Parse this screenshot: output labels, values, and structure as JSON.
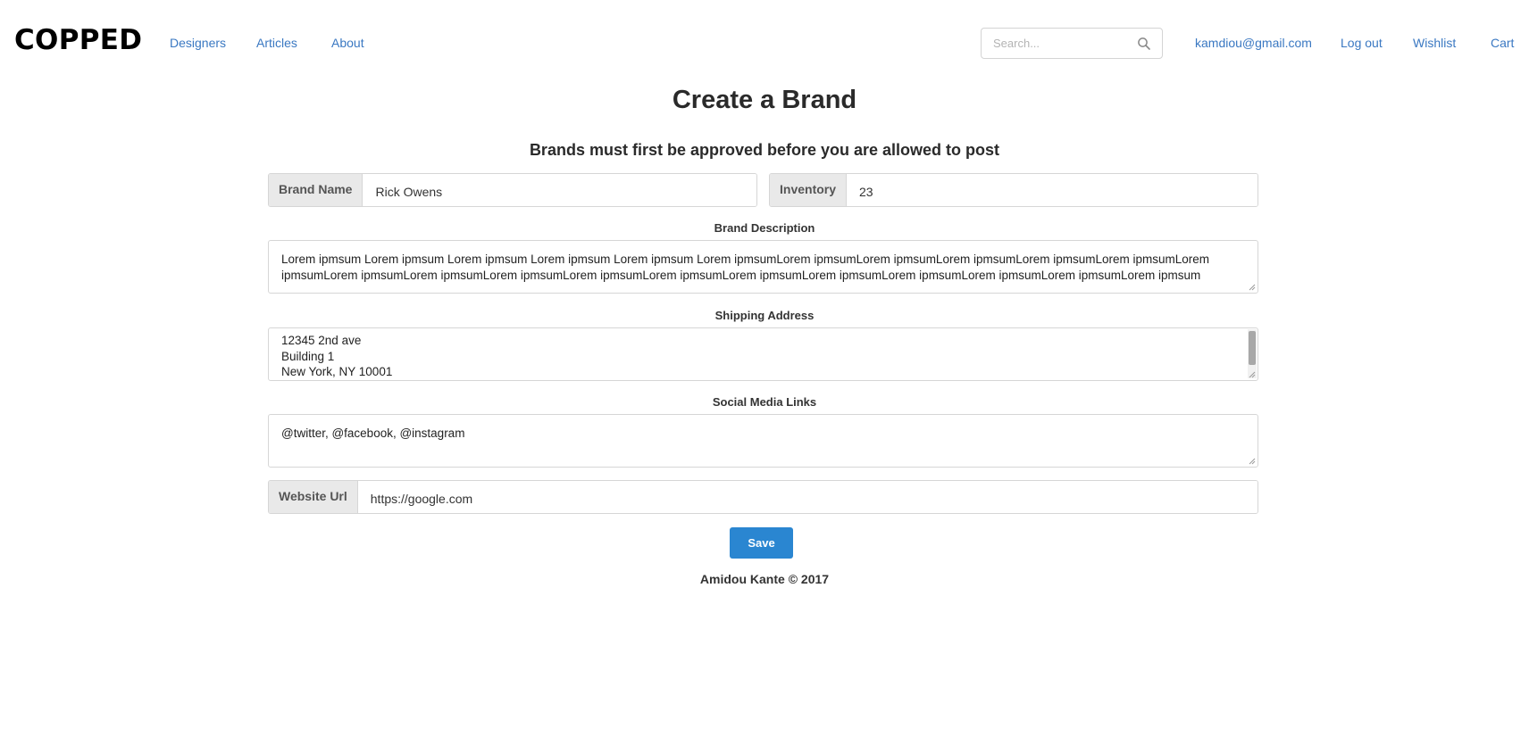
{
  "nav": {
    "logo": "COPPED",
    "links": [
      "Designers",
      "Articles",
      "About"
    ],
    "search_placeholder": "Search...",
    "user_email": "kamdiou@gmail.com",
    "logout": "Log out",
    "wishlist": "Wishlist",
    "cart": "Cart"
  },
  "page": {
    "title": "Create a Brand",
    "subtitle": "Brands must first be approved before you are allowed to post"
  },
  "form": {
    "brand_name_label": "Brand Name",
    "brand_name_value": "Rick Owens",
    "inventory_label": "Inventory",
    "inventory_value": "23",
    "description_label": "Brand Description",
    "description_lines": [
      "Lorem ipmsum Lorem ipmsum Lorem ipmsum Lorem ipmsum Lorem ipmsum Lorem ipmsumLorem ipmsumLorem ipmsumLorem ipmsumLorem ipmsumLorem ipmsumLorem",
      "ipmsumLorem ipmsumLorem ipmsumLorem ipmsumLorem ipmsumLorem ipmsumLorem ipmsumLorem ipmsumLorem ipmsumLorem ipmsumLorem ipmsumLorem ipmsum"
    ],
    "shipping_label": "Shipping Address",
    "shipping_lines": [
      "12345 2nd ave",
      "Building 1",
      "New York, NY 10001"
    ],
    "social_label": "Social Media Links",
    "social_value": "@twitter, @facebook, @instagram",
    "website_label": "Website Url",
    "website_value": "https://google.com",
    "save_label": "Save"
  },
  "footer": {
    "text": "Amidou Kante © 2017"
  },
  "colors": {
    "link": "#3a78c2",
    "button": "#2a86d1",
    "addon_bg": "#e9e9e9"
  }
}
